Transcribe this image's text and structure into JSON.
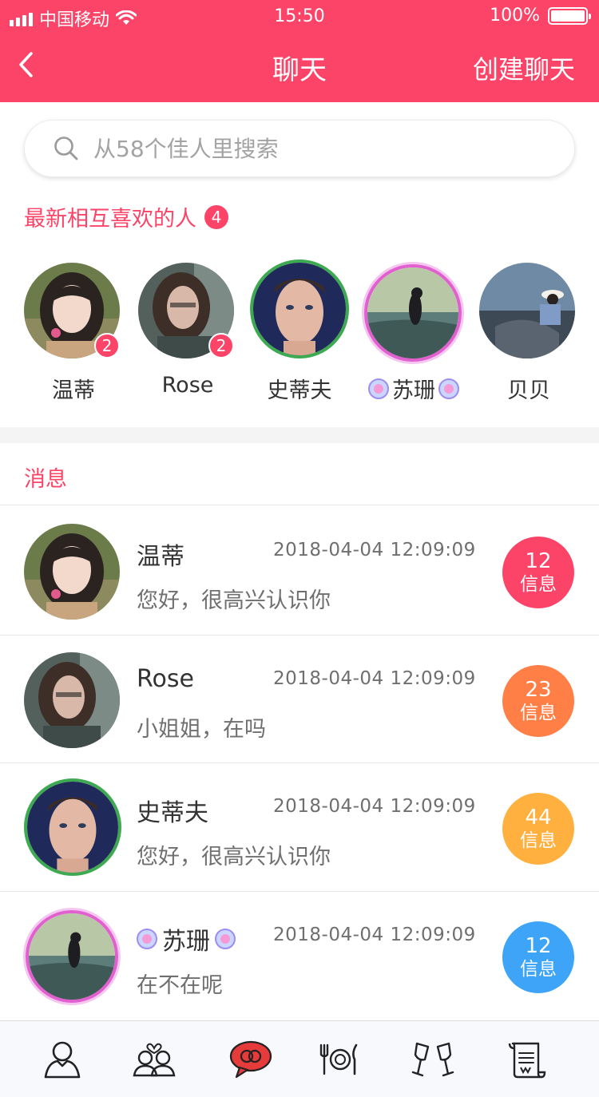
{
  "status_bar": {
    "carrier": "中国移动",
    "time": "15:50",
    "battery": "100%"
  },
  "nav": {
    "title": "聊天",
    "action": "创建聊天",
    "back_icon": "chevron-left-icon"
  },
  "search": {
    "placeholder": "从58个佳人里搜索"
  },
  "mutual": {
    "title": "最新相互喜欢的人",
    "count": "4",
    "people": [
      {
        "name": "温蒂",
        "badge": "2"
      },
      {
        "name": "Rose",
        "badge": "2"
      },
      {
        "name": "史蒂夫"
      },
      {
        "name": "苏珊"
      },
      {
        "name": "贝贝"
      }
    ]
  },
  "messages": {
    "title": "消息",
    "items": [
      {
        "name": "温蒂",
        "time": "2018-04-04   12:09:09",
        "text": "您好，很高兴认识你",
        "count": "12",
        "count_label": "信息",
        "color": "#fb4468"
      },
      {
        "name": "Rose",
        "time": "2018-04-04   12:09:09",
        "text": "小姐姐，在吗",
        "count": "23",
        "count_label": "信息",
        "color": "#ff7f46"
      },
      {
        "name": "史蒂夫",
        "time": "2018-04-04   12:09:09",
        "text": "您好，很高兴认识你",
        "count": "44",
        "count_label": "信息",
        "color": "#ffb03f"
      },
      {
        "name": "苏珊",
        "time": "2018-04-04   12:09:09",
        "text": "在不在呢",
        "count": "12",
        "count_label": "信息",
        "color": "#3ea4f7"
      }
    ]
  },
  "tabs": [
    {
      "icon": "profile-icon"
    },
    {
      "icon": "couple-icon"
    },
    {
      "icon": "chat-bubble-icon",
      "active": true
    },
    {
      "icon": "dining-icon"
    },
    {
      "icon": "cheers-icon"
    },
    {
      "icon": "scroll-icon"
    }
  ],
  "colors": {
    "accent": "#fb4468",
    "tab_active": "#e63b3b"
  }
}
